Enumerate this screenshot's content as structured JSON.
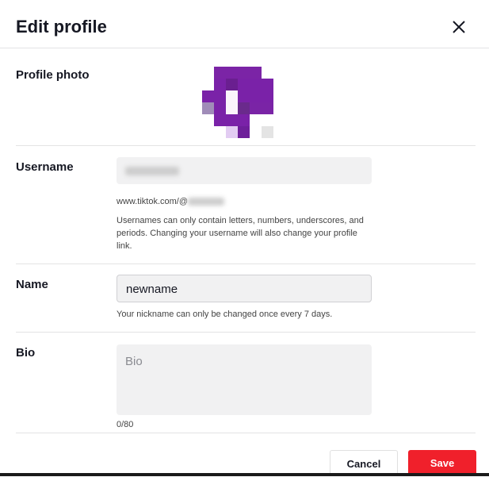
{
  "header": {
    "title": "Edit profile",
    "close_icon": "close-icon"
  },
  "profile_photo": {
    "label": "Profile photo"
  },
  "username": {
    "label": "Username",
    "value": "",
    "url_prefix": "www.tiktok.com/@",
    "hint": "Usernames can only contain letters, numbers, underscores, and periods. Changing your username will also change your profile link."
  },
  "name": {
    "label": "Name",
    "value": "newname",
    "hint": "Your nickname can only be changed once every 7 days."
  },
  "bio": {
    "label": "Bio",
    "placeholder": "Bio",
    "counter": "0/80"
  },
  "footer": {
    "cancel": "Cancel",
    "save": "Save"
  },
  "colors": {
    "accent": "#fe2c55",
    "save_bg": "#f0202b",
    "avatar_purple": "#7a22a8"
  }
}
